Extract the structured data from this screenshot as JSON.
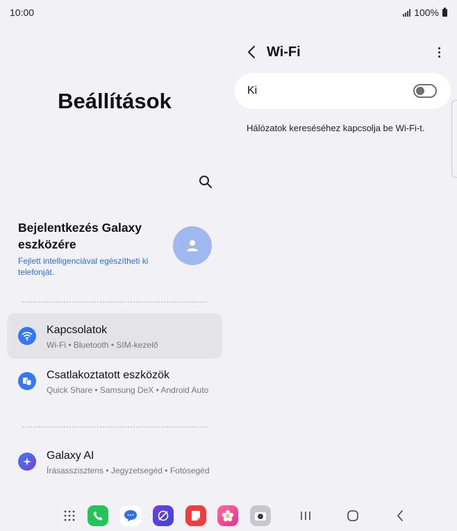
{
  "status_bar": {
    "time": "10:00",
    "battery_percent": "100%"
  },
  "left": {
    "title": "Beállítások",
    "account": {
      "title": "Bejelentkezés Galaxy eszközére",
      "subtitle": "Fejlett intelligenciával egészítheti ki telefonját."
    },
    "items": [
      {
        "title": "Kapcsolatok",
        "subtitle": "Wi-Fi  •  Bluetooth  •  SIM-kezelő",
        "icon": "wifi-icon",
        "color": "#3478f6"
      },
      {
        "title": "Csatlakoztatott eszközök",
        "subtitle": "Quick Share  •  Samsung DeX  •  Android Auto",
        "icon": "devices-icon",
        "color": "#3478f6"
      },
      {
        "title": "Galaxy AI",
        "subtitle": "Írásasszisztens  •  Jegyzetsegéd  •  Fotósegéd",
        "icon": "galaxy-ai-icon",
        "color": "#4b5fe0"
      }
    ]
  },
  "right": {
    "title": "Wi-Fi",
    "toggle_label": "Ki",
    "toggle_state": "off",
    "hint": "Hálózatok kereséséhez kapcsolja be Wi-Fi-t."
  },
  "dock": {
    "apps": [
      "apps-grid-icon",
      "phone-icon",
      "messages-icon",
      "internet-icon",
      "notes-icon",
      "gallery-icon",
      "camera-icon"
    ],
    "nav": [
      "recents-icon",
      "home-icon",
      "back-icon"
    ]
  }
}
